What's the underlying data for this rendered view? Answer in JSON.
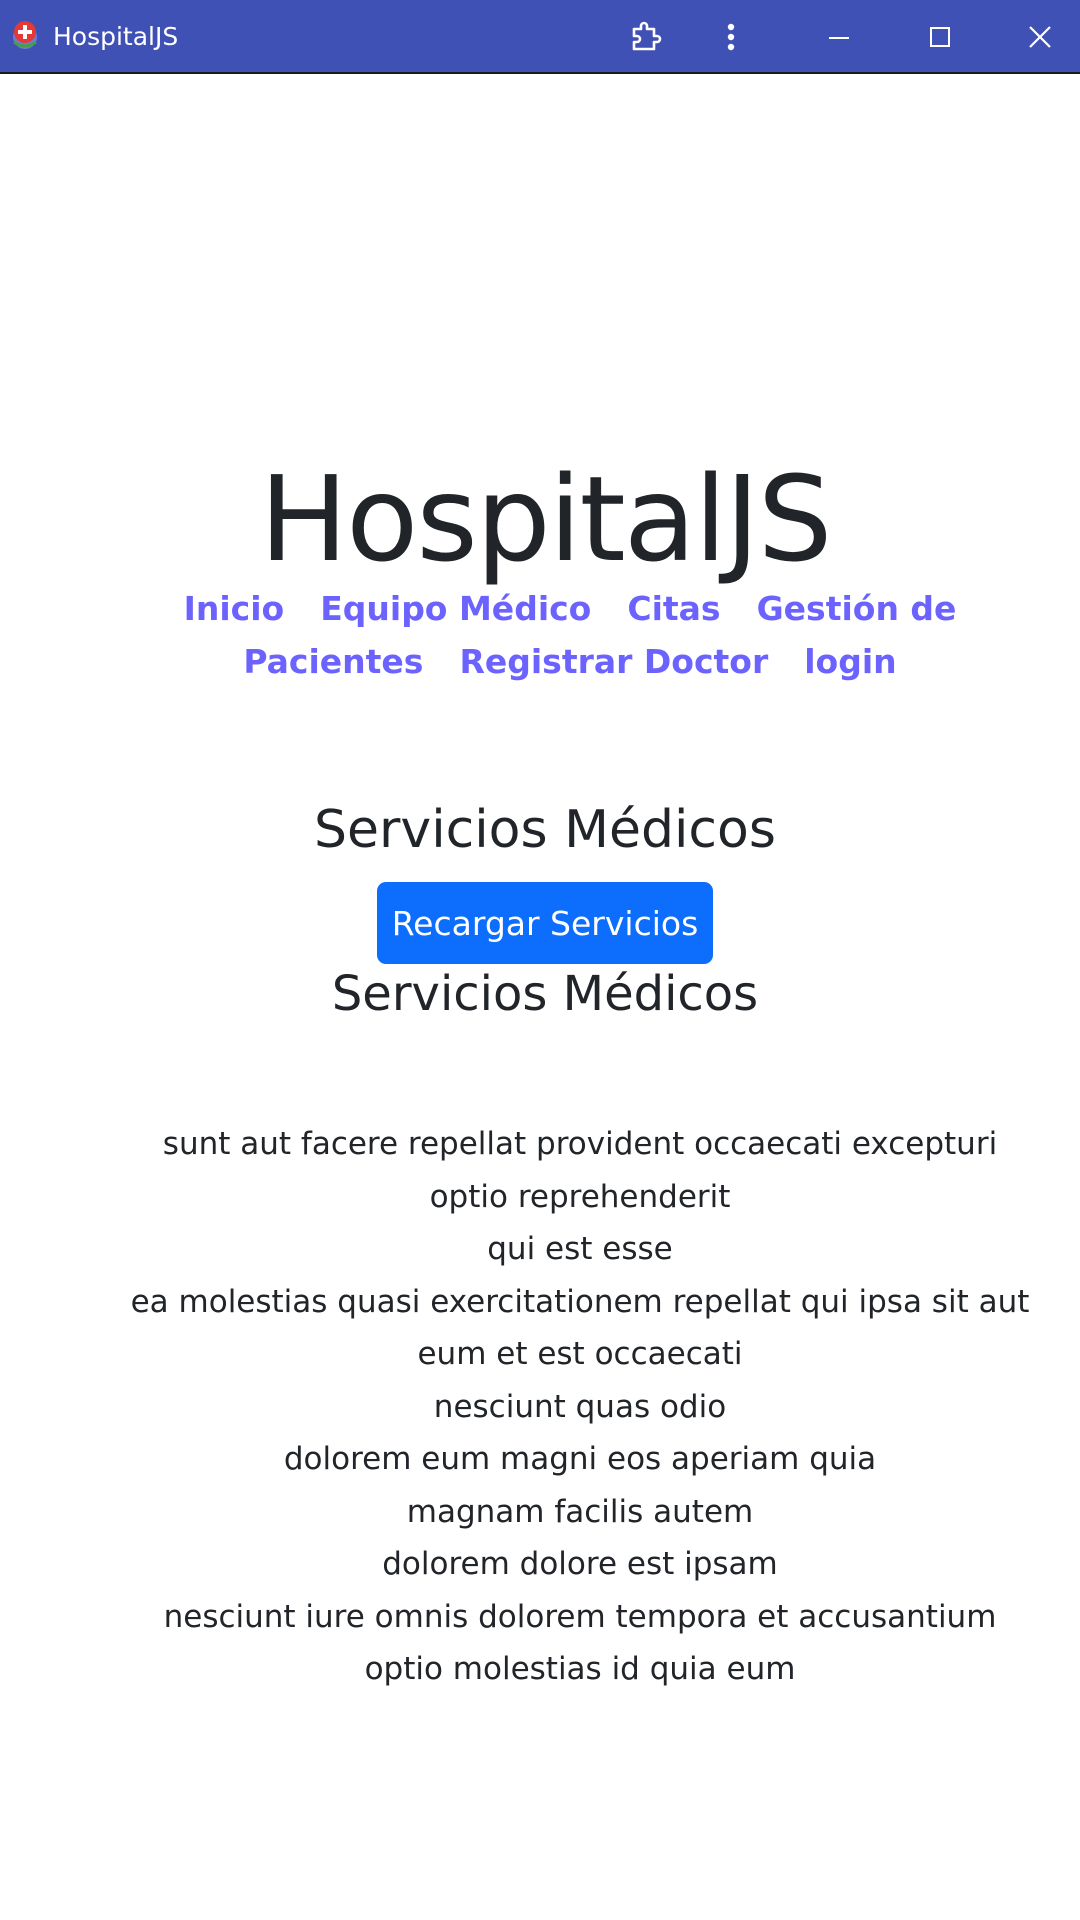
{
  "window": {
    "title": "HospitalJS"
  },
  "header": {
    "brand": "HospitalJS",
    "nav": {
      "inicio": "Inicio",
      "equipo": "Equipo Médico",
      "citas": "Citas",
      "gestion_1": "Gestión de",
      "gestion_2": "Pacientes",
      "registrar": "Registrar Doctor",
      "login": "login"
    }
  },
  "main": {
    "section_title": "Servicios Médicos",
    "reload_button": "Recargar Servicios",
    "list_title": "Servicios Médicos",
    "services": [
      "sunt aut facere repellat provident occaecati excepturi optio reprehenderit",
      "qui est esse",
      "ea molestias quasi exercitationem repellat qui ipsa sit aut",
      "eum et est occaecati",
      "nesciunt quas odio",
      "dolorem eum magni eos aperiam quia",
      "magnam facilis autem",
      "dolorem dolore est ipsam",
      "nesciunt iure omnis dolorem tempora et accusantium",
      "optio molestias id quia eum"
    ]
  },
  "colors": {
    "titlebar": "#3f51b5",
    "link": "#6c63ff",
    "button": "#0d6efd",
    "text": "#212529"
  },
  "icons": {
    "app": "red-cross-app-icon",
    "extension": "puzzle-icon",
    "menu": "more-vertical-icon",
    "minimize": "minimize-icon",
    "maximize": "maximize-icon",
    "close": "close-icon"
  }
}
